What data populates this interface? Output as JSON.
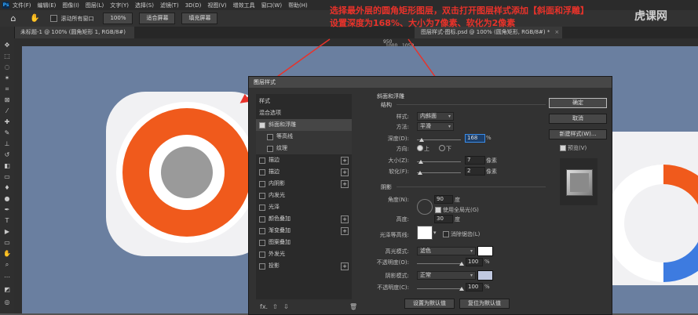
{
  "menubar": {
    "logo": "Ps",
    "items": [
      "文件(F)",
      "编辑(E)",
      "图像(I)",
      "图层(L)",
      "文字(Y)",
      "选择(S)",
      "滤镜(T)",
      "3D(D)",
      "视图(V)",
      "增效工具",
      "窗口(W)",
      "帮助(H)"
    ]
  },
  "options": {
    "scroll_all_label": "滚动所有窗口",
    "zoom_value": "100%",
    "fit_screen_label": "适合屏幕",
    "fill_screen_label": "填充屏幕"
  },
  "tabs": [
    {
      "label": "未标题-1 @ 100% (圆角矩形 1, RGB/8#) *"
    },
    {
      "label": "图层样式-图标.psd @ 100% (圆角矩形, RGB/8#) *"
    }
  ],
  "ruler": {
    "marks": [
      "950",
      "1000",
      "1050"
    ]
  },
  "annotation": {
    "line1": "选择最外层的圆角矩形图层，双击打开图层样式添加【斜面和浮雕】",
    "line2": "设置深度为168%、大小为7像素、软化为2像素"
  },
  "watermark": "虎课网",
  "dialog": {
    "title": "图层样式",
    "styles_header": "样式",
    "blend_options": "混合选项",
    "style_items": [
      {
        "label": "斜面和浮雕",
        "checked": true,
        "plus": false,
        "active": true,
        "sub": false
      },
      {
        "label": "等高线",
        "checked": false,
        "plus": false,
        "active": false,
        "sub": true
      },
      {
        "label": "纹理",
        "checked": false,
        "plus": false,
        "active": false,
        "sub": true
      },
      {
        "label": "描边",
        "checked": false,
        "plus": true,
        "active": false,
        "sub": false
      },
      {
        "label": "描边",
        "checked": false,
        "plus": true,
        "active": false,
        "sub": false
      },
      {
        "label": "内阴影",
        "checked": false,
        "plus": true,
        "active": false,
        "sub": false
      },
      {
        "label": "内发光",
        "checked": false,
        "plus": false,
        "active": false,
        "sub": false
      },
      {
        "label": "光泽",
        "checked": false,
        "plus": false,
        "active": false,
        "sub": false
      },
      {
        "label": "颜色叠加",
        "checked": false,
        "plus": true,
        "active": false,
        "sub": false
      },
      {
        "label": "渐变叠加",
        "checked": false,
        "plus": true,
        "active": false,
        "sub": false
      },
      {
        "label": "图案叠加",
        "checked": false,
        "plus": false,
        "active": false,
        "sub": false
      },
      {
        "label": "外发光",
        "checked": false,
        "plus": false,
        "active": false,
        "sub": false
      },
      {
        "label": "投影",
        "checked": false,
        "plus": true,
        "active": false,
        "sub": false
      }
    ],
    "fx_label": "fx.",
    "bevel": {
      "section_title": "斜面和浮雕",
      "structure_title": "结构",
      "style_label": "样式:",
      "style_value": "内斜面",
      "method_label": "方法:",
      "method_value": "平滑",
      "depth_label": "深度(D):",
      "depth_value": "168",
      "depth_unit": "%",
      "direction_label": "方向:",
      "dir_up": "上",
      "dir_down": "下",
      "size_label": "大小(Z):",
      "size_value": "7",
      "size_unit": "像素",
      "soften_label": "软化(F):",
      "soften_value": "2",
      "soften_unit": "像素"
    },
    "shading": {
      "section_title": "阴影",
      "angle_label": "角度(N):",
      "angle_value": "90",
      "angle_unit": "度",
      "global_light_label": "使用全局光(G)",
      "altitude_label": "高度:",
      "altitude_value": "30",
      "altitude_unit": "度",
      "gloss_label": "光泽等高线:",
      "antialias_label": "消除锯齿(L)",
      "highlight_mode_label": "高光模式:",
      "highlight_mode_value": "滤色",
      "highlight_opacity_label": "不透明度(O):",
      "highlight_opacity_value": "100",
      "shadow_mode_label": "阴影模式:",
      "shadow_mode_value": "正常",
      "shadow_opacity_label": "不透明度(C):",
      "shadow_opacity_value": "100",
      "pct": "%",
      "highlight_color": "#ffffff",
      "shadow_color": "#c0c8e0"
    },
    "default_btn": "设置为默认值",
    "reset_btn": "复位为默认值",
    "ok_btn": "确定",
    "cancel_btn": "取消",
    "new_style_btn": "新建样式(W)...",
    "preview_label": "预览(V)"
  },
  "colors": {
    "accent_orange": "#f05a1c",
    "canvas_bg": "#6a7fa0",
    "annotation_red": "#e8322a"
  }
}
